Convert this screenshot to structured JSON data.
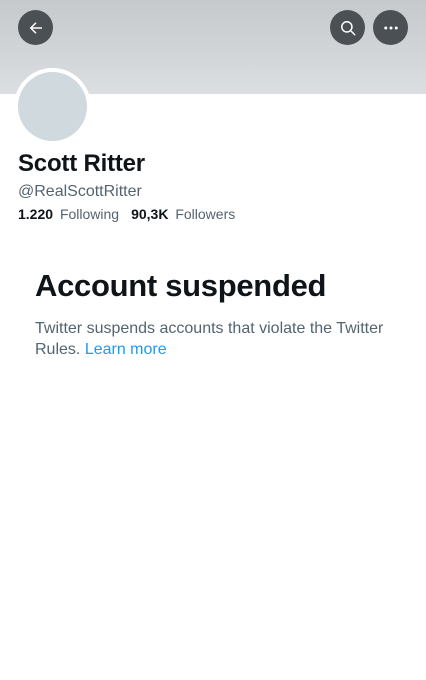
{
  "header": {
    "back_icon": "arrow-left-icon",
    "search_icon": "search-icon",
    "more_icon": "more-horizontal-icon"
  },
  "profile": {
    "name": "Scott Ritter",
    "handle": "@RealScottRitter",
    "following_count": "1.220",
    "following_label": "Following",
    "followers_count": "90,3K",
    "followers_label": "Followers"
  },
  "notice": {
    "title": "Account suspended",
    "description": "Twitter suspends accounts that violate the Twitter Rules.",
    "link_label": "Learn more"
  },
  "colors": {
    "text_primary": "#0f1419",
    "text_secondary": "#536471",
    "link": "#1d9bf0",
    "button_bg": "#4b5054",
    "banner": "#cfd2d5"
  }
}
